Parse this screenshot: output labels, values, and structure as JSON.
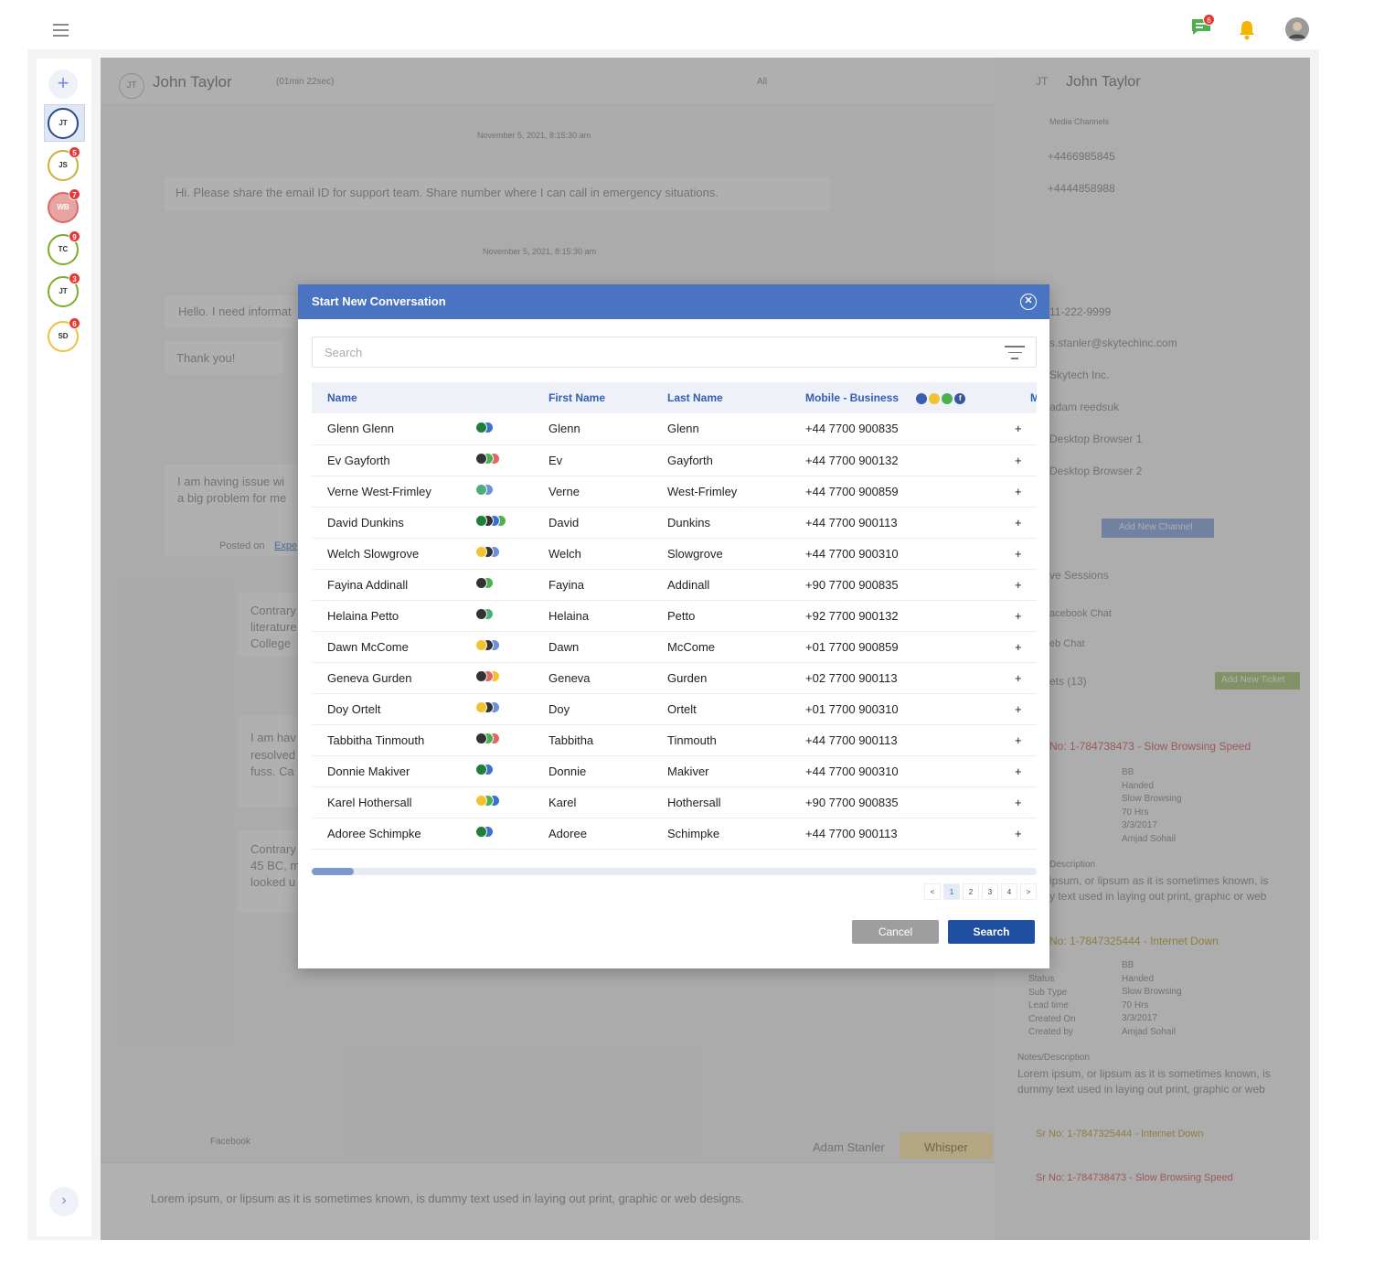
{
  "topbar": {
    "menu_icon": "hamburger-icon",
    "chat_badge": "6",
    "chat_icon": "chat-icon",
    "bell_icon": "bell-icon",
    "avatar_icon": "user-avatar"
  },
  "rail": {
    "add_icon": "plus-icon",
    "expand_icon": "chevron-right-icon",
    "avatars": [
      {
        "initials": "JT",
        "badge": "",
        "color": "#2a4c8a"
      },
      {
        "initials": "JS",
        "badge": "5",
        "color": "#c8b23a"
      },
      {
        "initials": "WB",
        "badge": "7",
        "color": "#d56b6b"
      },
      {
        "initials": "TC",
        "badge": "9",
        "color": "#7fab2f"
      },
      {
        "initials": "JT",
        "badge": "3",
        "color": "#7fab2f"
      },
      {
        "initials": "SD",
        "badge": "6",
        "color": "#f0c23b"
      }
    ]
  },
  "chat": {
    "contact_initials": "JT",
    "contact_name": "John Taylor",
    "duration": "(01min 22sec)",
    "filter_value": "All",
    "date1": "November 5, 2021, 8:15:30 am",
    "msg1": "Hi. Please share the email ID for support team. Share number where I can call in emergency situations.",
    "date2": "November 5, 2021, 8:15:30 am",
    "msg2": "Hello. I need informat",
    "msg3": "Thank you!",
    "msg4a": "I am having issue wi",
    "msg4b": "a big problem for me",
    "posted_on": "Posted on",
    "posted_link": "Expe",
    "msg5a": "Contrary",
    "msg5b": "literature",
    "msg5c": "College",
    "msg6a": "I am hav",
    "msg6b": "resolved",
    "msg6c": "fuss. Ca",
    "msg7a": "Contrary",
    "msg7b": "45 BC, m",
    "msg7c": "looked u",
    "agent_name": "Adam Stanler",
    "whisper_label": "Whisper",
    "channel_label": "Facebook",
    "composer_text": "Lorem ipsum, or lipsum as it is sometimes known, is dummy text used in laying out print, graphic or web designs."
  },
  "right": {
    "initials": "JT",
    "name": "John Taylor",
    "media_channels": "Media Channels",
    "phone1": "+4466985845",
    "phone2": "+4444858988",
    "phone3": "11-222-9999",
    "email": "s.stanler@skytechinc.com",
    "company": "Skytech Inc.",
    "user": "adam reedsuk",
    "browser1": "Desktop Browser 1",
    "browser2": "Desktop Browser 2",
    "add_channel": "Add New Channel",
    "sessions": "ve Sessions",
    "facebook_chat": "acebook Chat",
    "web_chat": "eb Chat",
    "tickets": "ets (13)",
    "add_ticket": "Add New Ticket",
    "ticket1": "No: 1-784738473 - Slow Browsing Speed",
    "t1_values": [
      "BB",
      "Handed",
      "Slow Browsing",
      "70 Hrs",
      "3/3/2017",
      "Amjad Sohail"
    ],
    "desc_label": "Description",
    "desc1": "ipsum, or lipsum as it is sometimes known, is",
    "desc2": "y text used in laying out print, graphic or web",
    "ticket2": "No: 1-7847325444 - Internet Down",
    "t2_labels": [
      "Status",
      "Sub Type",
      "Lead time",
      "Created On",
      "Created by"
    ],
    "t2_values": [
      "BB",
      "Handed",
      "Slow Browsing",
      "70 Hrs",
      "3/3/2017",
      "Amjad Sohail"
    ],
    "notes_label": "Notes/Description",
    "notes1": "Lorem ipsum, or lipsum as it is sometimes known, is",
    "notes2": "dummy text used in laying out print, graphic or web",
    "sr1": "Sr No: 1-7847325444 - Internet Down",
    "sr2": "Sr No: 1-784738473 - Slow Browsing Speed"
  },
  "modal": {
    "title": "Start New Conversation",
    "close_icon": "close-circle-icon",
    "search_placeholder": "Search",
    "filter_icon": "filter-icon",
    "columns": {
      "name": "Name",
      "first_name": "First Name",
      "last_name": "Last Name",
      "mobile": "Mobile - Business",
      "next": "M"
    },
    "rows": [
      {
        "name": "Glenn Glenn",
        "first": "Glenn",
        "last": "Glenn",
        "mobile": "+44 7700 900835",
        "dots": [
          "#1e7e3a",
          "#3f6fd1"
        ]
      },
      {
        "name": "Ev Gayforth",
        "first": "Ev",
        "last": "Gayforth",
        "mobile": "+44 7700 900132",
        "dots": [
          "#333333",
          "#4caf50",
          "#e06666"
        ]
      },
      {
        "name": "Verne West-Frimley",
        "first": "Verne",
        "last": "West-Frimley",
        "mobile": "+44 7700 900859",
        "dots": [
          "#4caf7a",
          "#6f8fd8"
        ]
      },
      {
        "name": "David Dunkins",
        "first": "David",
        "last": "Dunkins",
        "mobile": "+44 7700 900113",
        "dots": [
          "#1e7e3a",
          "#333333",
          "#3f6fd1",
          "#4caf50"
        ]
      },
      {
        "name": "Welch Slowgrove",
        "first": "Welch",
        "last": "Slowgrove",
        "mobile": "+44 7700 900310",
        "dots": [
          "#f2c230",
          "#333333",
          "#6f8fd8"
        ]
      },
      {
        "name": "Fayina Addinall",
        "first": "Fayina",
        "last": "Addinall",
        "mobile": "+90 7700 900835",
        "dots": [
          "#333333",
          "#4caf50"
        ]
      },
      {
        "name": "Helaina Petto",
        "first": "Helaina",
        "last": "Petto",
        "mobile": "+92 7700 900132",
        "dots": [
          "#333333",
          "#4caf7a"
        ]
      },
      {
        "name": "Dawn McCome",
        "first": "Dawn",
        "last": "McCome",
        "mobile": "+01 7700 900859",
        "dots": [
          "#f2c230",
          "#333333",
          "#6f8fd8"
        ]
      },
      {
        "name": "Geneva Gurden",
        "first": "Geneva",
        "last": "Gurden",
        "mobile": "+02 7700 900113",
        "dots": [
          "#333333",
          "#e06666",
          "#f2c230"
        ]
      },
      {
        "name": "Doy Ortelt",
        "first": "Doy",
        "last": "Ortelt",
        "mobile": "+01 7700 900310",
        "dots": [
          "#f2c230",
          "#333333",
          "#6f8fd8"
        ]
      },
      {
        "name": "Tabbitha Tinmouth",
        "first": "Tabbitha",
        "last": "Tinmouth",
        "mobile": "+44 7700 900113",
        "dots": [
          "#333333",
          "#4caf50",
          "#e06666"
        ]
      },
      {
        "name": "Donnie Makiver",
        "first": "Donnie",
        "last": "Makiver",
        "mobile": "+44 7700 900310",
        "dots": [
          "#1e7e3a",
          "#3f6fd1"
        ]
      },
      {
        "name": "Karel Hothersall",
        "first": "Karel",
        "last": "Hothersall",
        "mobile": "+90 7700 900835",
        "dots": [
          "#f2c230",
          "#4caf50",
          "#3f6fd1"
        ]
      },
      {
        "name": "Adoree Schimpke",
        "first": "Adoree",
        "last": "Schimpke",
        "mobile": "+44 7700 900113",
        "dots": [
          "#1e7e3a",
          "#3f6fd1"
        ]
      }
    ],
    "row_suffix": "+",
    "pager": [
      "<",
      "1",
      "2",
      "3",
      "4",
      ">"
    ],
    "pager_active": "1",
    "cancel_label": "Cancel",
    "search_label": "Search"
  }
}
